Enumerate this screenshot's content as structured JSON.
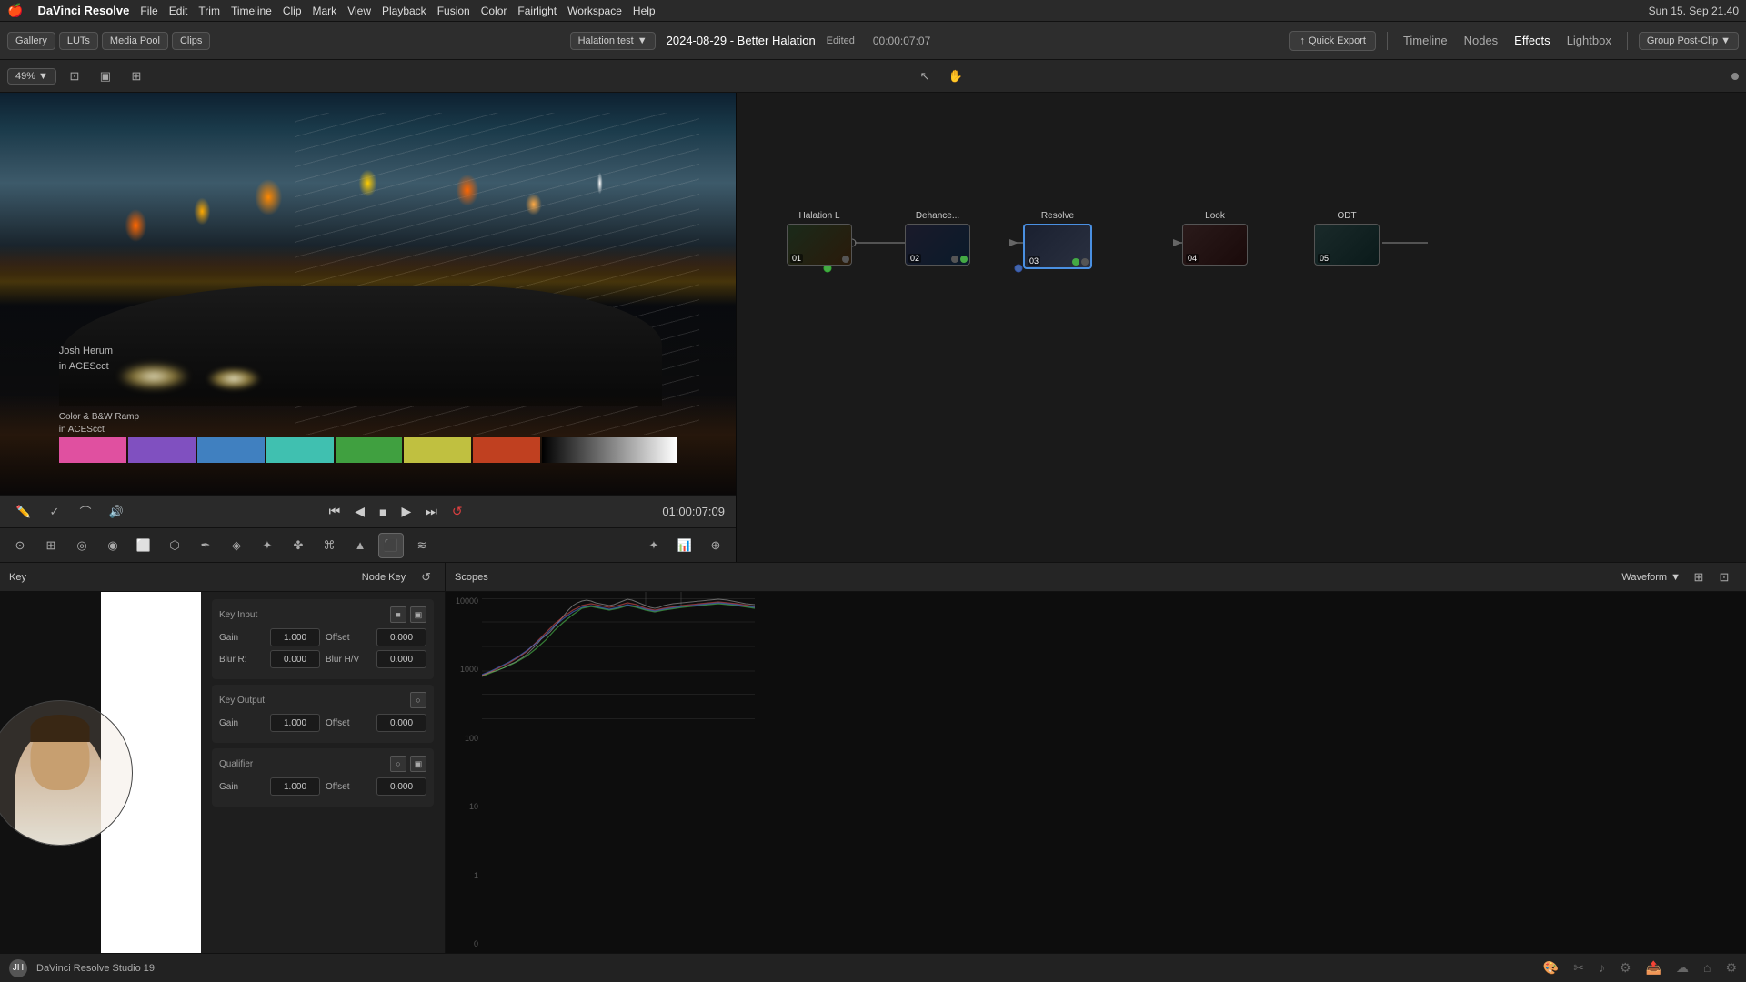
{
  "menubar": {
    "apple": "🍎",
    "app_name": "DaVinci Resolve",
    "items": [
      "File",
      "Edit",
      "Trim",
      "Timeline",
      "Clip",
      "Mark",
      "View",
      "Playback",
      "Fusion",
      "Color",
      "Fairlight",
      "Workspace",
      "Help"
    ],
    "right": {
      "time": "Sun 15. Sep 21.40"
    }
  },
  "toolbar": {
    "gallery": "Gallery",
    "luts": "LUTs",
    "media_pool": "Media Pool",
    "clips": "Clips",
    "project_title": "2024-08-29 - Better Halation",
    "edited": "Edited",
    "clip_name": "Halation test",
    "timecode": "00:00:07:07",
    "quick_export": "Quick Export",
    "timeline": "Timeline",
    "nodes": "Nodes",
    "effects": "Effects",
    "lightbox": "Lightbox",
    "group_post_clip": "Group Post-Clip"
  },
  "subtoolbar": {
    "zoom": "49%"
  },
  "viewer": {
    "overlay_name": "Josh Herum",
    "overlay_sub": "in ACEScct",
    "colorbar_label": "Color & B&W Ramp",
    "colorbar_sub": "in ACEScct"
  },
  "transport": {
    "timecode": "01:00:07:09"
  },
  "nodes": {
    "items": [
      {
        "label": "Halation L",
        "number": "01",
        "active": false
      },
      {
        "label": "Dehance...",
        "number": "02",
        "active": false
      },
      {
        "label": "Resolve",
        "number": "03",
        "active": true
      },
      {
        "label": "Look",
        "number": "04",
        "active": false
      },
      {
        "label": "ODT",
        "number": "05",
        "active": false
      }
    ]
  },
  "panels": {
    "key_label": "Key",
    "node_key_label": "Node Key",
    "scopes_label": "Scopes",
    "waveform_label": "Waveform",
    "key_input_label": "Key Input",
    "gain_label": "Gain",
    "gain_value": "1.000",
    "offset_label": "Offset",
    "offset_value": "0.000",
    "blur_r_label": "Blur R:",
    "blur_r_value": "0.000",
    "blur_hv_label": "Blur H/V",
    "blur_hv_value": "0.000",
    "key_output_label": "Key Output",
    "key_output_gain": "1.000",
    "key_output_offset": "0.000",
    "qualifier_label": "Qualifier",
    "qualifier_gain": "1.000",
    "qualifier_offset": "0.000"
  },
  "waveform": {
    "labels": [
      "10000",
      "1000",
      "100",
      "10",
      "1",
      "0"
    ],
    "colors": {
      "red": "#e05050",
      "green": "#50c050",
      "blue": "#5080e0",
      "yellow": "#c0c040",
      "white": "#aaaaaa"
    }
  },
  "statusbar": {
    "name": "DaVinci Resolve Studio 19",
    "bottom_tabs": [
      "color",
      "music",
      "settings",
      "star",
      "cloud",
      "home",
      "gear"
    ]
  }
}
